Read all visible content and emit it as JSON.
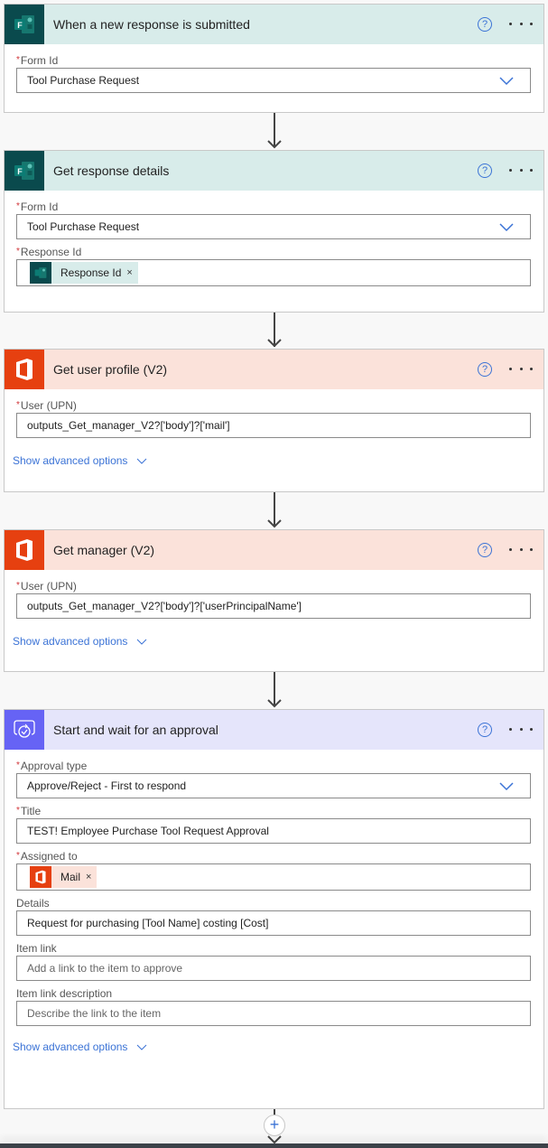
{
  "cards": [
    {
      "title": "When a new response is submitted",
      "fields": [
        {
          "label": "Form Id",
          "required": true,
          "value": "Tool Purchase Request",
          "type": "dropdown"
        }
      ]
    },
    {
      "title": "Get response details",
      "fields": [
        {
          "label": "Form Id",
          "required": true,
          "value": "Tool Purchase Request",
          "type": "dropdown"
        },
        {
          "label": "Response Id",
          "required": true,
          "token": "Response Id",
          "type": "token"
        }
      ]
    },
    {
      "title": "Get user profile (V2)",
      "fields": [
        {
          "label": "User (UPN)",
          "required": true,
          "value": "outputs_Get_manager_V2?['body']?['mail']",
          "type": "text"
        }
      ],
      "advanced_label": "Show advanced options"
    },
    {
      "title": "Get manager (V2)",
      "fields": [
        {
          "label": "User (UPN)",
          "required": true,
          "value": "outputs_Get_manager_V2?['body']?['userPrincipalName']",
          "type": "text"
        }
      ],
      "advanced_label": "Show advanced options"
    },
    {
      "title": "Start and wait for an approval",
      "fields": [
        {
          "label": "Approval type",
          "required": true,
          "value": "Approve/Reject - First to respond",
          "type": "dropdown"
        },
        {
          "label": "Title",
          "required": true,
          "value": "TEST! Employee Purchase Tool Request Approval",
          "type": "text"
        },
        {
          "label": "Assigned to",
          "required": true,
          "token": "Mail",
          "type": "token"
        },
        {
          "label": "Details",
          "required": false,
          "value": "Request for purchasing [Tool Name] costing [Cost]",
          "type": "text"
        },
        {
          "label": "Item link",
          "required": false,
          "placeholder": "Add a link to the item to approve",
          "type": "text"
        },
        {
          "label": "Item link description",
          "required": false,
          "placeholder": "Describe the link to the item",
          "type": "text"
        }
      ],
      "advanced_label": "Show advanced options"
    }
  ],
  "required_mark": "*",
  "token_remove": "×",
  "help_glyph": "?",
  "add_step_glyph": "+",
  "colors": {
    "forms_header": "#d8ecea",
    "forms_icon_bg": "#0a4a4d",
    "office_header": "#fbe2da",
    "office_icon_bg": "#e64010",
    "approval_header": "#e5e5fb",
    "approval_icon_bg": "#6663f5",
    "link": "#3b73d6",
    "required": "#d13438"
  }
}
